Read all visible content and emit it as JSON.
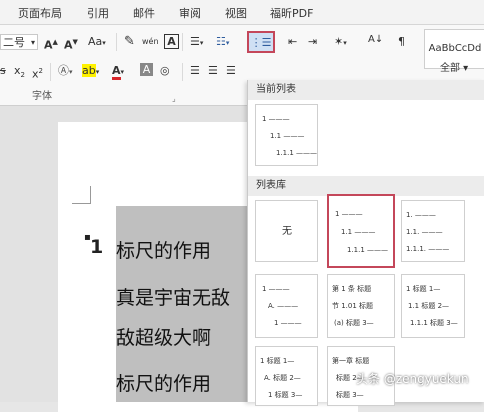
{
  "tabs": [
    "页面布局",
    "引用",
    "邮件",
    "审阅",
    "视图",
    "福昕PDF"
  ],
  "font": {
    "size": "二号",
    "grow": "A",
    "shrink": "A",
    "case": "Aa",
    "phonetic": "wén",
    "border_char": "A",
    "subscript": "x",
    "superscript": "x",
    "strike": "s",
    "group_label": "字体"
  },
  "styles": {
    "preview": "AaBbCcDd",
    "dropdown": "全部"
  },
  "panel": {
    "current_section": "当前列表",
    "library_section": "列表库",
    "current_tile": [
      "1 ———",
      "1.1 ———",
      "1.1.1 ———"
    ],
    "none_label": "无",
    "tiles": [
      [
        "1 ———",
        "1.1 ———",
        "1.1.1 ———"
      ],
      [
        "1. ———",
        "1.1. ———",
        "1.1.1. ———"
      ],
      [
        "1 ———",
        "A. ———",
        "1 ———"
      ],
      [
        "第 1 条 标题",
        "节 1.01 标题",
        "(a) 标题 3—"
      ],
      [
        "1 标题 1—",
        "1.1 标题 2—",
        "1.1.1 标题 3—"
      ],
      [
        "1 标题 1—",
        "A. 标题 2—",
        "1 标题 3—"
      ],
      [
        "第一章 标题",
        "标题 2—",
        "标题 3—"
      ]
    ]
  },
  "document": {
    "number": "1",
    "lines": [
      "标尺的作用",
      "真是宇宙无敌",
      "敌超级大啊",
      "标尺的作用"
    ]
  },
  "watermark": "头条 @zengyuekun"
}
